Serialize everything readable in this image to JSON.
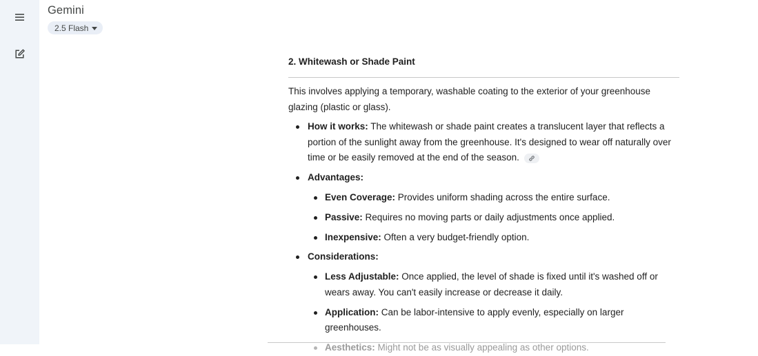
{
  "app": {
    "title": "Gemini",
    "model_label": "2.5 Flash"
  },
  "sidebar": {
    "menu_icon": "hamburger-menu-icon",
    "new_chat_icon": "edit-note-icon"
  },
  "response": {
    "heading": "2. Whitewash or Shade Paint",
    "intro": "This involves applying a temporary, washable coating to the exterior of your greenhouse glazing (plastic or glass).",
    "how_label": "How it works:",
    "how_text": " The whitewash or shade paint creates a translucent layer that reflects a portion of the sunlight away from the greenhouse. It's designed to wear off naturally over time or be easily removed at the end of the season.",
    "advantages_label": "Advantages:",
    "advantages": [
      {
        "label": "Even Coverage:",
        "text": " Provides uniform shading across the entire surface."
      },
      {
        "label": "Passive:",
        "text": " Requires no moving parts or daily adjustments once applied."
      },
      {
        "label": "Inexpensive:",
        "text": " Often a very budget-friendly option."
      }
    ],
    "considerations_label": "Considerations:",
    "considerations": [
      {
        "label": "Less Adjustable:",
        "text": " Once applied, the level of shade is fixed until it's washed off or wears away. You can't easily increase or decrease it daily."
      },
      {
        "label": "Application:",
        "text": " Can be labor-intensive to apply evenly, especially on larger greenhouses."
      },
      {
        "label": "Aesthetics:",
        "text": " Might not be as visually appealing as other options."
      }
    ]
  },
  "colors": {
    "sidebar_bg": "#f0f4f9",
    "pill_bg": "#e9eef6",
    "text": "#1f1f1f",
    "muted": "#444746"
  }
}
